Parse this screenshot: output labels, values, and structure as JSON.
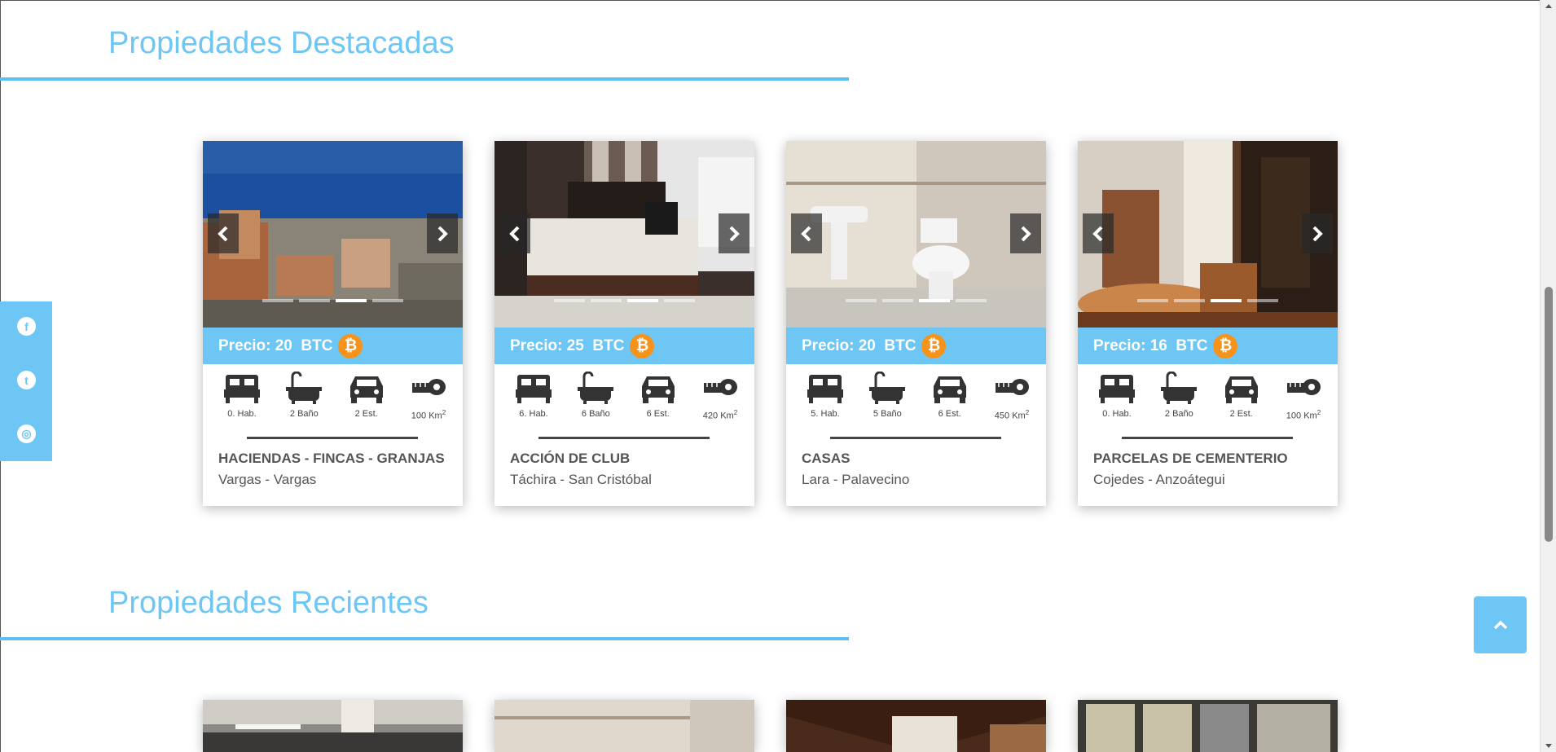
{
  "sections": {
    "featured_title": "Propiedades Destacadas",
    "recent_title": "Propiedades Recientes"
  },
  "colors": {
    "accent": "#6ec6f5",
    "bitcoin": "#f7931a"
  },
  "featured": [
    {
      "price_label": "Precio: 20  BTC",
      "beds": "0. Hab.",
      "baths": "2 Baño",
      "parking": "2 Est.",
      "area": "100 Km",
      "area_sup": "2",
      "category": "HACIENDAS - FINCAS - GRANJAS",
      "location": "Vargas - Vargas",
      "active_slide": 3
    },
    {
      "price_label": "Precio: 25  BTC",
      "beds": "6. Hab.",
      "baths": "6 Baño",
      "parking": "6 Est.",
      "area": "420 Km",
      "area_sup": "2",
      "category": "ACCIÓN DE CLUB",
      "location": "Táchira - San Cristóbal",
      "active_slide": 3
    },
    {
      "price_label": "Precio: 20  BTC",
      "beds": "5. Hab.",
      "baths": "5 Baño",
      "parking": "6 Est.",
      "area": "450 Km",
      "area_sup": "2",
      "category": "CASAS",
      "location": "Lara - Palavecino",
      "active_slide": 3
    },
    {
      "price_label": "Precio: 16  BTC",
      "beds": "0. Hab.",
      "baths": "2 Baño",
      "parking": "2 Est.",
      "area": "100 Km",
      "area_sup": "2",
      "category": "PARCELAS DE CEMENTERIO",
      "location": "Cojedes - Anzoátegui",
      "active_slide": 3
    }
  ],
  "icons": {
    "social": [
      "facebook-icon",
      "twitter-icon",
      "instagram-icon"
    ],
    "bitcoin_symbol": "₿",
    "facebook_glyph": "f",
    "twitter_glyph": "t",
    "instagram_glyph": "◎"
  }
}
